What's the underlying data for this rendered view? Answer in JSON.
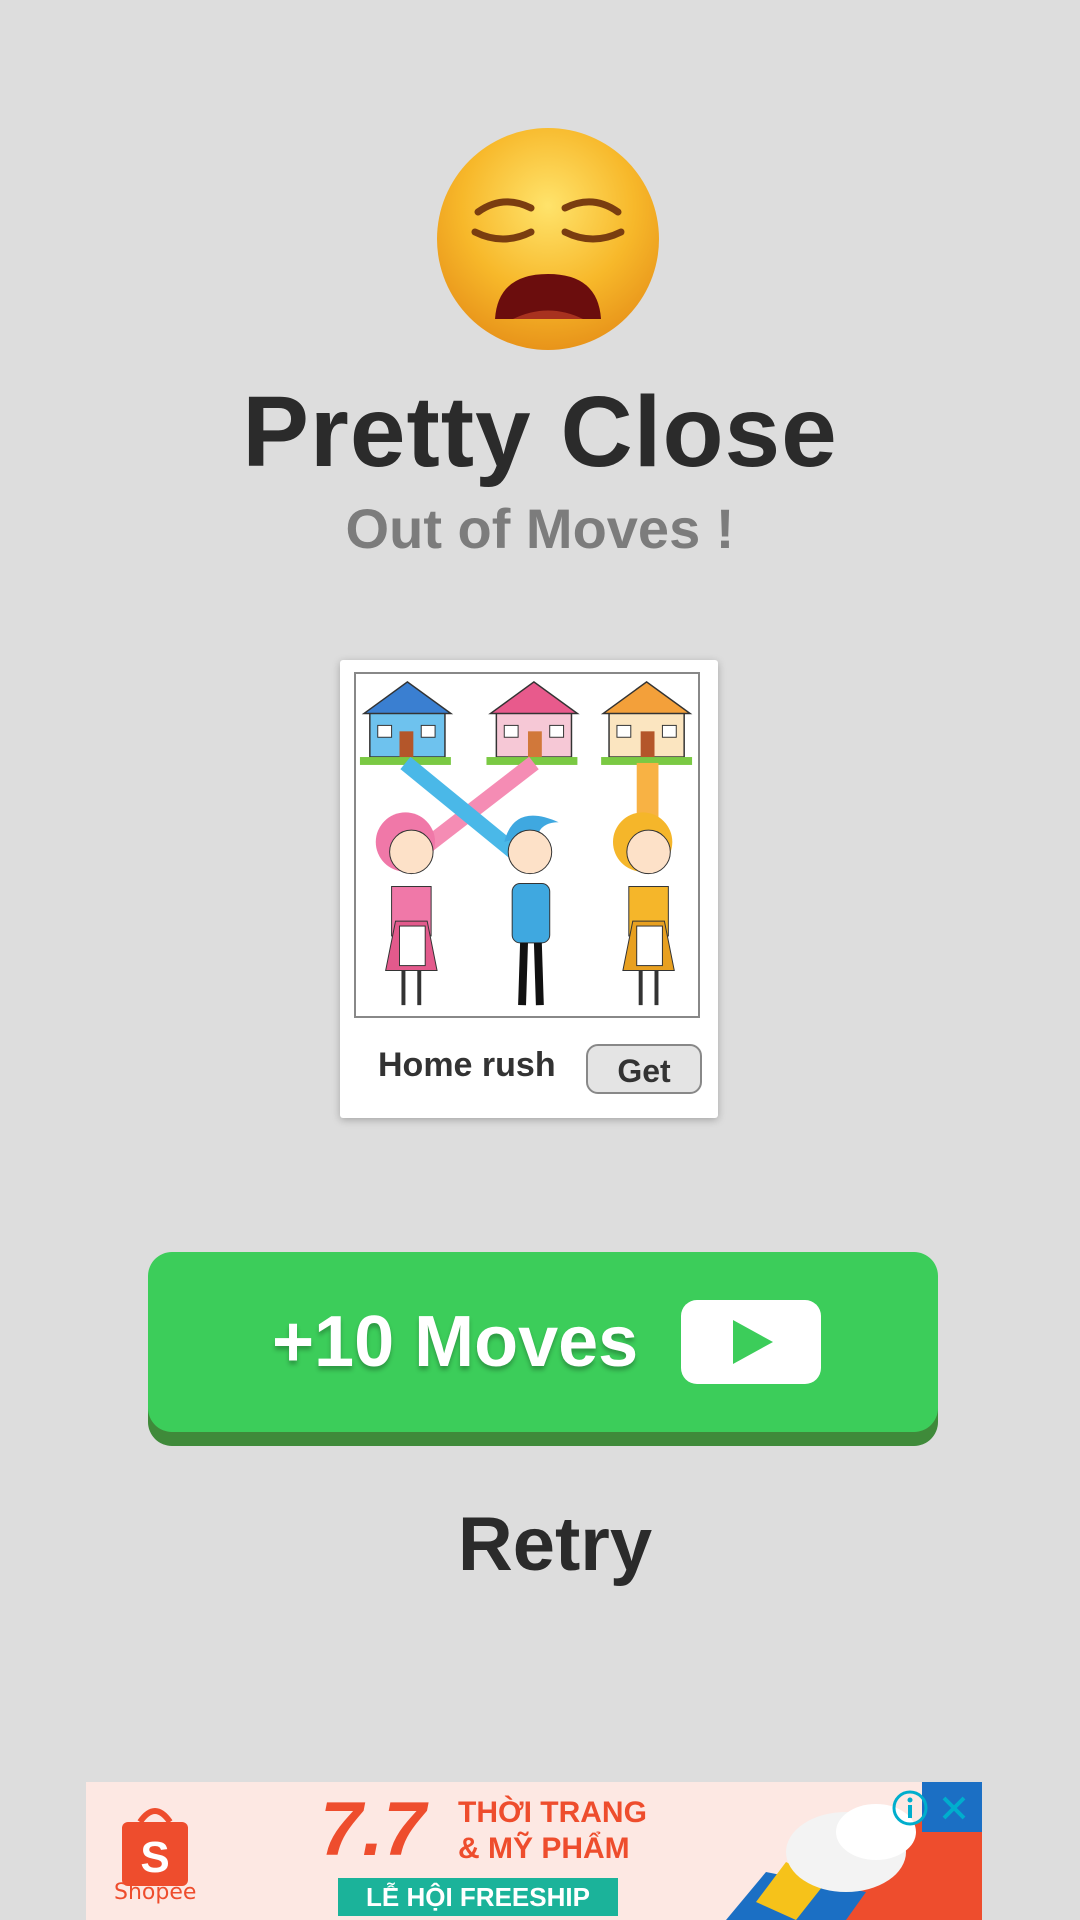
{
  "result": {
    "emoji_icon": "weary-face-icon",
    "title": "Pretty Close",
    "subtitle": "Out of Moves !"
  },
  "ad_card": {
    "app_name": "Home rush",
    "get_label": "Get",
    "artwork_icon": "home-rush-game-artwork"
  },
  "actions": {
    "moves_label": "+10 Moves",
    "moves_icon": "play-video-icon",
    "retry_label": "Retry"
  },
  "banner_ad": {
    "brand": "Shopee",
    "promo_number": "7.7",
    "promo_line1": "THỜI TRANG",
    "promo_line2": "& MỸ PHẨM",
    "promo_bar": "LỄ HỘI FREESHIP",
    "info_icon": "ad-info-icon",
    "close_icon": "close-icon"
  },
  "colors": {
    "background": "#dddddd",
    "moves_button": "#3ccd5a",
    "moves_button_shadow": "#3f8a3a",
    "shopee_orange": "#ee4d2d"
  }
}
